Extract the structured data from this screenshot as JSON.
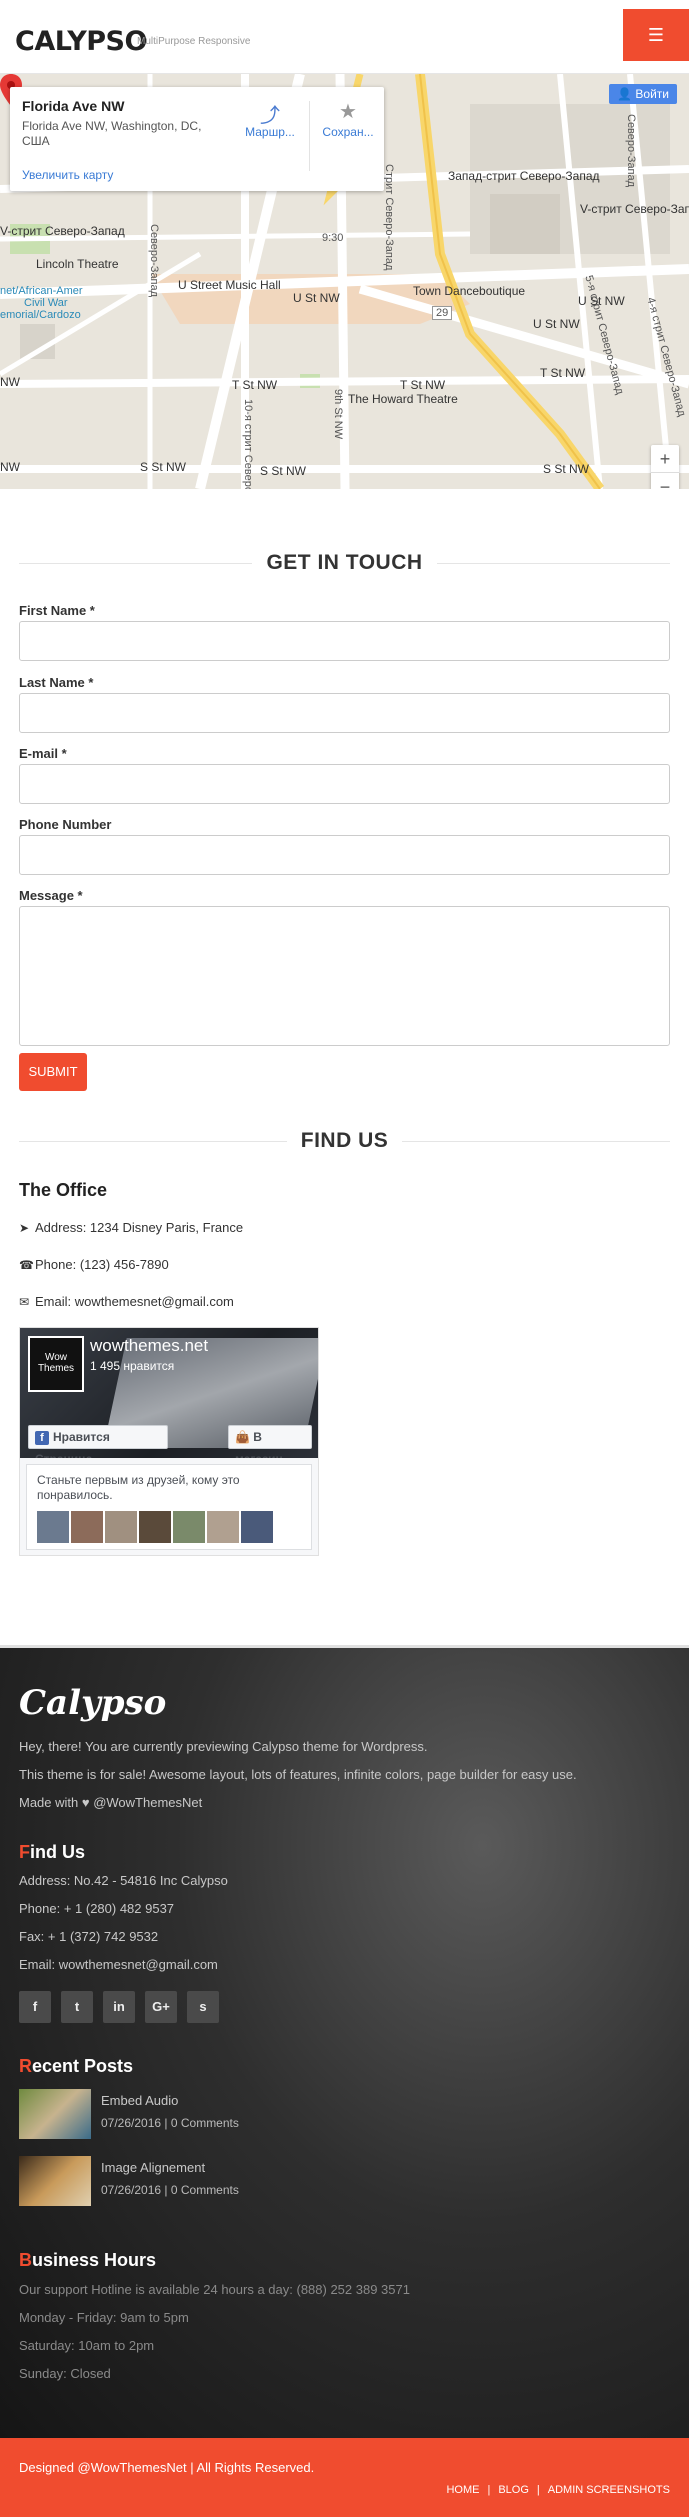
{
  "header": {
    "logo": "CALYPSO",
    "tagline": "MultiPurpose Responsive",
    "menu_icon": "hamburger-icon"
  },
  "map": {
    "card": {
      "title": "Florida Ave NW",
      "address": "Florida Ave NW, Washington, DC, США",
      "enlarge_link": "Увеличить карту",
      "directions_label": "Маршр...",
      "save_label": "Сохран..."
    },
    "login_button": "Войти",
    "zoom_in": "+",
    "zoom_out": "−",
    "labels": {
      "lincoln": "Lincoln Theatre",
      "ustreet": "U Street Music Hall",
      "ust": "U St NW",
      "town": "Town Danceboutique",
      "tst_left": "T St NW",
      "tst_mid": "T St NW",
      "tst_right": "T St NW",
      "howard": "The Howard Theatre",
      "sst1": "S St NW",
      "sst2": "S St NW",
      "sst3": "S St NW",
      "nw_left": "NW",
      "nw_left2": "NW",
      "ust_right": "U St NW",
      "ust_right2": "U St NW",
      "vstreet_left": "V-стрит Северо-Запад",
      "vstreet_right": "V-стрит Северо-Запад",
      "zapad": "Запад-стрит Северо-Запад",
      "time": "9:30",
      "african": "net/African-Amer",
      "civil": "Civil War",
      "memorial": "emorial/Cardozo",
      "route": "29",
      "ninth": "9th St NW",
      "tenth": "10-я стрит Северо",
      "fifth": "5-я стрит Северо-Запад",
      "fourth": "4-я стрит Северо-Запад",
      "vertical_left": "Северо-Запад",
      "vertical_top": "Стрит Северо-Запад",
      "vertical_top2": "Северо-Запад"
    }
  },
  "contact": {
    "title": "GET IN TOUCH",
    "fields": {
      "first_name": "First Name *",
      "last_name": "Last Name *",
      "email": "E-mail *",
      "phone": "Phone Number",
      "message": "Message *"
    },
    "submit": "SUBMIT"
  },
  "find_us": {
    "title": "FIND US",
    "office_title": "The Office",
    "address": "Address: 1234 Disney Paris, France",
    "phone": "Phone: (123) 456-7890",
    "email": "Email: wowthemesnet@gmail.com"
  },
  "facebook": {
    "avatar_text": "Wow Themes",
    "name": "wowthemes.net",
    "likes": "1 495 нравится",
    "like_button": "Нравится Страница",
    "shop_button": "В магазин",
    "friends_text": "Станьте первым из друзей, кому это понравилось."
  },
  "footer": {
    "logo": "Calypso",
    "intro1": "Hey, there! You are currently previewing Calypso theme for Wordpress.",
    "intro2": "This theme is for sale! Awesome layout, lots of features, infinite colors, page builder for easy use.",
    "made_with": "Made with ♥ @WowThemesNet",
    "find_us": {
      "heading_first": "F",
      "heading_rest": "ind Us",
      "address": "Address: No.42 - 54816 Inc Calypso",
      "phone": "Phone: + 1 (280) 482 9537",
      "fax": "Fax: + 1 (372) 742 9532",
      "email": "Email: wowthemesnet@gmail.com"
    },
    "social": [
      "f",
      "t",
      "in",
      "G+",
      "s"
    ],
    "recent_posts": {
      "heading_first": "R",
      "heading_rest": "ecent Posts",
      "posts": [
        {
          "title": "Embed Audio",
          "meta": "07/26/2016 | 0 Comments"
        },
        {
          "title": "Image Alignement",
          "meta": "07/26/2016 | 0 Comments"
        }
      ]
    },
    "business_hours": {
      "heading_first": "B",
      "heading_rest": "usiness Hours",
      "hotline": "Our support Hotline is available 24 hours a day: (888) 252 389 3571",
      "weekdays": "Monday - Friday: 9am to 5pm",
      "saturday": "Saturday: 10am to 2pm",
      "sunday": "Sunday: Closed"
    }
  },
  "bottom_bar": {
    "copyright": "Designed @WowThemesNet | All Rights Reserved.",
    "nav": [
      "HOME",
      "BLOG",
      "ADMIN SCREENSHOTS"
    ],
    "separator": "|"
  },
  "colors": {
    "accent": "#f04c2f",
    "footer_bg": "#2e2e2e",
    "map_bg": "#e9e5dc",
    "link_blue": "#3a7bd5"
  }
}
